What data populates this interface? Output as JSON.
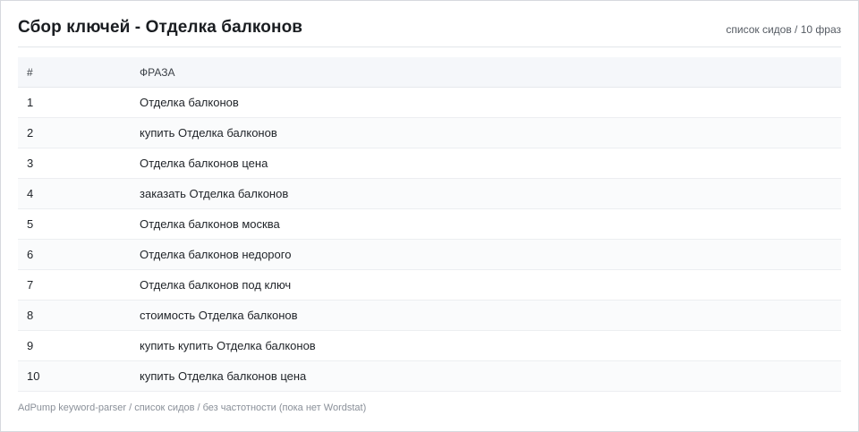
{
  "header": {
    "title": "Сбор ключей - Отделка балконов",
    "subtitle": "список сидов / 10 фраз"
  },
  "table": {
    "columns": [
      "#",
      "ФРАЗА"
    ],
    "rows": [
      {
        "num": "1",
        "phrase": "Отделка балконов"
      },
      {
        "num": "2",
        "phrase": "купить Отделка балконов"
      },
      {
        "num": "3",
        "phrase": "Отделка балконов цена"
      },
      {
        "num": "4",
        "phrase": "заказать Отделка балконов"
      },
      {
        "num": "5",
        "phrase": "Отделка балконов москва"
      },
      {
        "num": "6",
        "phrase": "Отделка балконов недорого"
      },
      {
        "num": "7",
        "phrase": "Отделка балконов под ключ"
      },
      {
        "num": "8",
        "phrase": "стоимость Отделка балконов"
      },
      {
        "num": "9",
        "phrase": "купить купить Отделка балконов"
      },
      {
        "num": "10",
        "phrase": "купить Отделка балконов цена"
      }
    ]
  },
  "footer": {
    "text": "AdPump keyword-parser / список сидов / без частотности (пока нет Wordstat)"
  }
}
